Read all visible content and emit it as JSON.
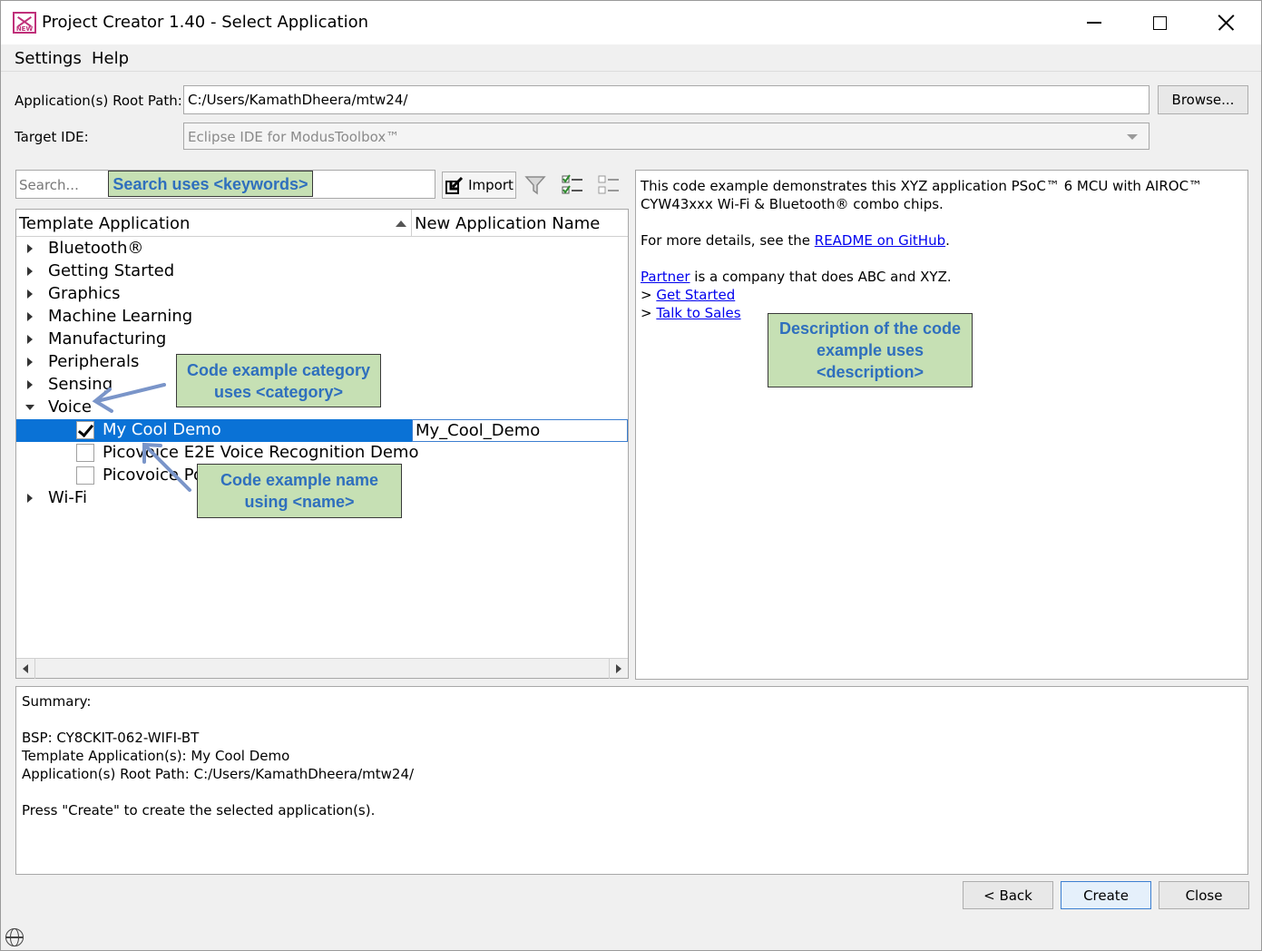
{
  "window": {
    "title": "Project Creator 1.40 - Select Application",
    "icon_label": "NEW"
  },
  "menu": {
    "settings": "Settings",
    "help": "Help"
  },
  "form": {
    "root_path_label": "Application(s) Root Path:",
    "root_path_value": "C:/Users/KamathDheera/mtw24/",
    "browse_label": "Browse...",
    "target_ide_label": "Target IDE:",
    "target_ide_value": "Eclipse IDE for ModusToolbox™"
  },
  "toolbar": {
    "search_placeholder": "Search...",
    "import_label": "Import"
  },
  "table": {
    "col_template": "Template Application",
    "col_name": "New Application Name",
    "categories": [
      "Bluetooth®",
      "Getting Started",
      "Graphics",
      "Machine Learning",
      "Manufacturing",
      "Peripherals",
      "Sensing",
      "Voice"
    ],
    "voice_items": [
      {
        "label": "My Cool Demo",
        "checked": true,
        "app_name": "My_Cool_Demo"
      },
      {
        "label": "Picovoice E2E Voice Recognition Demo",
        "checked": false
      },
      {
        "label": "Picovoice Po",
        "checked": false
      }
    ],
    "last_category": "Wi-Fi"
  },
  "description": {
    "line1": "This code example demonstrates this XYZ application PSoC™ 6 MCU with AIROC™",
    "line2": "CYW43xxx Wi-Fi & Bluetooth® combo chips.",
    "details_prefix": "For more details, see the ",
    "readme_link": "README on GitHub",
    "details_suffix": ".",
    "partner_link": "Partner",
    "partner_text": " is a company that does ABC and XYZ.",
    "get_started_prefix": "> ",
    "get_started_link": "Get Started",
    "talk_prefix": "> ",
    "talk_link": "Talk to Sales"
  },
  "summary": {
    "heading": "Summary:",
    "bsp": "BSP: CY8CKIT-062-WIFI-BT",
    "template": "Template Application(s): My Cool Demo",
    "root_path": "Application(s) Root Path: C:/Users/KamathDheera/mtw24/",
    "instruction": "Press \"Create\" to create the selected application(s)."
  },
  "buttons": {
    "back": "< Back",
    "create": "Create",
    "close": "Close"
  },
  "annotations": {
    "search": "Search uses <keywords>",
    "category_line1": "Code example category",
    "category_line2": "uses <category>",
    "name_line1": "Code example name",
    "name_line2": "using <name>",
    "desc_line1": "Description of the code",
    "desc_line2": "example uses",
    "desc_line3": "<description>"
  }
}
